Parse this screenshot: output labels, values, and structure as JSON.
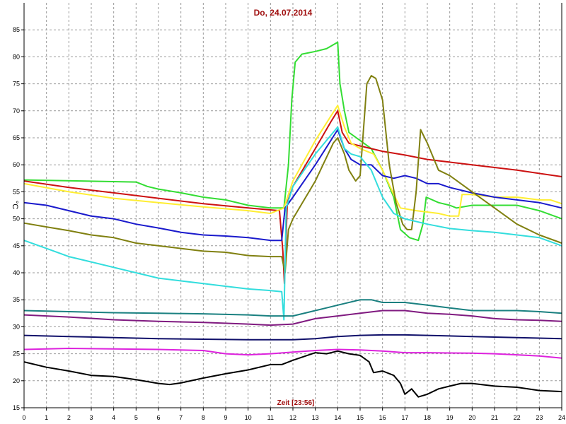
{
  "chart_data": {
    "type": "line",
    "title": "Do, 24.07.2014",
    "xlabel": "Zeit [23:56]",
    "ylabel": "°C",
    "xlim": [
      0,
      24
    ],
    "ylim": [
      15,
      90
    ],
    "xticks": [
      0,
      1,
      2,
      3,
      4,
      5,
      6,
      7,
      8,
      9,
      10,
      11,
      12,
      13,
      14,
      15,
      16,
      17,
      18,
      19,
      20,
      21,
      22,
      23,
      24
    ],
    "yticks": [
      15,
      20,
      25,
      30,
      35,
      40,
      45,
      50,
      55,
      60,
      65,
      70,
      75,
      80,
      85
    ],
    "grid": true,
    "colors": {
      "background": "#ffffff",
      "grid": "#9a9a9a",
      "axis": "#000000"
    },
    "series": [
      {
        "color": "#33dd33",
        "points": [
          [
            0,
            57.2
          ],
          [
            5,
            56.8
          ],
          [
            5.5,
            56
          ],
          [
            6,
            55.5
          ],
          [
            7,
            54.8
          ],
          [
            8,
            54
          ],
          [
            9,
            53.5
          ],
          [
            10,
            52.5
          ],
          [
            11,
            52
          ],
          [
            11.6,
            52
          ],
          [
            11.8,
            60
          ],
          [
            11.95,
            72
          ],
          [
            12.1,
            79
          ],
          [
            12.4,
            80.5
          ],
          [
            13,
            81
          ],
          [
            13.5,
            81.5
          ],
          [
            14,
            82.7
          ],
          [
            14.1,
            75
          ],
          [
            14.3,
            70
          ],
          [
            14.5,
            66
          ],
          [
            15,
            64.5
          ],
          [
            15.5,
            63
          ],
          [
            16,
            59
          ],
          [
            16.5,
            54
          ],
          [
            16.8,
            48
          ],
          [
            17.2,
            46.5
          ],
          [
            17.6,
            46
          ],
          [
            17.8,
            49
          ],
          [
            17.95,
            54
          ],
          [
            18.5,
            53
          ],
          [
            19,
            52.5
          ],
          [
            19.3,
            52
          ],
          [
            20,
            52.5
          ],
          [
            21,
            52.5
          ],
          [
            22,
            52.5
          ],
          [
            23,
            51.5
          ],
          [
            24,
            50
          ]
        ]
      },
      {
        "color": "#cc1111",
        "points": [
          [
            0,
            57
          ],
          [
            2,
            55.8
          ],
          [
            4,
            54.8
          ],
          [
            6,
            53.8
          ],
          [
            8,
            52.8
          ],
          [
            10,
            52
          ],
          [
            11.4,
            51.5
          ],
          [
            11.55,
            44
          ],
          [
            11.62,
            38
          ],
          [
            11.75,
            53
          ],
          [
            12,
            56
          ],
          [
            13,
            63
          ],
          [
            13.7,
            68
          ],
          [
            14,
            70
          ],
          [
            14.2,
            66
          ],
          [
            14.5,
            64
          ],
          [
            15,
            63.5
          ],
          [
            16,
            62.5
          ],
          [
            17,
            61.8
          ],
          [
            18,
            61
          ],
          [
            20,
            60
          ],
          [
            22,
            59
          ],
          [
            24,
            57.8
          ]
        ]
      },
      {
        "color": "#ffee33",
        "points": [
          [
            0,
            56.5
          ],
          [
            2,
            55
          ],
          [
            4,
            53.8
          ],
          [
            6,
            53
          ],
          [
            8,
            52.2
          ],
          [
            10,
            51.5
          ],
          [
            11,
            51
          ],
          [
            11.6,
            52
          ],
          [
            12,
            57
          ],
          [
            13,
            64.5
          ],
          [
            14,
            71
          ],
          [
            14.3,
            67
          ],
          [
            14.6,
            64
          ],
          [
            15,
            63
          ],
          [
            15.6,
            62
          ],
          [
            16,
            59
          ],
          [
            16.5,
            54.5
          ],
          [
            16.8,
            52
          ],
          [
            17.5,
            51.5
          ],
          [
            18.5,
            51
          ],
          [
            19,
            50.5
          ],
          [
            19.4,
            50.5
          ],
          [
            19.55,
            54.5
          ],
          [
            20,
            54.5
          ],
          [
            21,
            54
          ],
          [
            22,
            54
          ],
          [
            23,
            53.5
          ],
          [
            23.5,
            53.5
          ],
          [
            24,
            52.8
          ]
        ]
      },
      {
        "color": "#1a1acc",
        "points": [
          [
            0,
            53
          ],
          [
            1,
            52.5
          ],
          [
            2,
            51.5
          ],
          [
            3,
            50.5
          ],
          [
            4,
            50
          ],
          [
            5,
            49
          ],
          [
            6,
            48.3
          ],
          [
            7,
            47.5
          ],
          [
            8,
            47
          ],
          [
            9,
            46.8
          ],
          [
            10,
            46.5
          ],
          [
            11,
            46
          ],
          [
            11.5,
            46
          ],
          [
            11.65,
            52
          ],
          [
            12,
            54
          ],
          [
            13,
            60
          ],
          [
            14,
            66.5
          ],
          [
            14.3,
            63
          ],
          [
            14.6,
            61
          ],
          [
            15,
            60
          ],
          [
            15.5,
            60
          ],
          [
            16,
            58
          ],
          [
            16.5,
            57.5
          ],
          [
            17,
            58
          ],
          [
            17.5,
            57.5
          ],
          [
            18,
            56.5
          ],
          [
            18.5,
            56.5
          ],
          [
            19,
            55.8
          ],
          [
            20,
            54.8
          ],
          [
            21,
            54
          ],
          [
            22,
            53.5
          ],
          [
            23,
            53
          ],
          [
            24,
            52
          ]
        ]
      },
      {
        "color": "#808010",
        "points": [
          [
            0,
            49.2
          ],
          [
            1,
            48.5
          ],
          [
            2,
            47.8
          ],
          [
            3,
            47
          ],
          [
            4,
            46.5
          ],
          [
            5,
            45.5
          ],
          [
            6,
            45
          ],
          [
            7,
            44.5
          ],
          [
            8,
            44
          ],
          [
            9,
            43.8
          ],
          [
            10,
            43.2
          ],
          [
            11,
            43
          ],
          [
            11.5,
            43
          ],
          [
            11.65,
            40
          ],
          [
            11.8,
            48
          ],
          [
            12,
            50
          ],
          [
            13,
            57
          ],
          [
            13.8,
            64
          ],
          [
            14,
            65
          ],
          [
            14.3,
            62
          ],
          [
            14.5,
            59
          ],
          [
            14.8,
            57
          ],
          [
            15,
            58
          ],
          [
            15.3,
            75
          ],
          [
            15.5,
            76.5
          ],
          [
            15.7,
            76
          ],
          [
            16,
            72
          ],
          [
            16.3,
            60
          ],
          [
            16.6,
            53
          ],
          [
            16.9,
            49
          ],
          [
            17.1,
            48
          ],
          [
            17.3,
            48
          ],
          [
            17.5,
            55
          ],
          [
            17.7,
            66.5
          ],
          [
            18,
            64
          ],
          [
            18.5,
            59
          ],
          [
            19,
            58
          ],
          [
            20,
            55
          ],
          [
            21,
            52
          ],
          [
            22,
            49
          ],
          [
            23,
            47
          ],
          [
            24,
            45.5
          ]
        ]
      },
      {
        "color": "#33dddd",
        "points": [
          [
            0,
            46
          ],
          [
            1,
            44.5
          ],
          [
            2,
            43
          ],
          [
            3,
            42
          ],
          [
            4,
            41
          ],
          [
            5,
            40
          ],
          [
            6,
            39
          ],
          [
            7,
            38.5
          ],
          [
            8,
            38
          ],
          [
            9,
            37.5
          ],
          [
            10,
            37
          ],
          [
            11,
            36.7
          ],
          [
            11.5,
            36.5
          ],
          [
            11.6,
            31.3
          ],
          [
            11.7,
            52
          ],
          [
            12,
            56
          ],
          [
            13,
            62
          ],
          [
            14,
            67
          ],
          [
            14.3,
            63
          ],
          [
            14.6,
            62
          ],
          [
            15,
            61.5
          ],
          [
            15.5,
            59
          ],
          [
            15.8,
            56
          ],
          [
            16,
            54
          ],
          [
            16.5,
            51
          ],
          [
            17,
            50
          ],
          [
            18,
            49
          ],
          [
            19,
            48.2
          ],
          [
            20,
            47.8
          ],
          [
            21,
            47.5
          ],
          [
            22,
            47
          ],
          [
            23,
            46.5
          ],
          [
            24,
            45
          ]
        ]
      },
      {
        "color": "#1a8080",
        "points": [
          [
            0,
            33
          ],
          [
            2,
            32.8
          ],
          [
            4,
            32.6
          ],
          [
            6,
            32.5
          ],
          [
            8,
            32.4
          ],
          [
            10,
            32.2
          ],
          [
            11,
            32
          ],
          [
            12,
            32
          ],
          [
            13,
            33
          ],
          [
            13.5,
            33.5
          ],
          [
            14,
            34
          ],
          [
            15,
            35
          ],
          [
            15.5,
            35
          ],
          [
            16,
            34.5
          ],
          [
            17,
            34.5
          ],
          [
            18,
            34
          ],
          [
            19,
            33.5
          ],
          [
            20,
            33
          ],
          [
            22,
            33
          ],
          [
            23,
            32.8
          ],
          [
            24,
            32.5
          ]
        ]
      },
      {
        "color": "#801a80",
        "points": [
          [
            0,
            32.2
          ],
          [
            2,
            31.8
          ],
          [
            4,
            31.3
          ],
          [
            6,
            31
          ],
          [
            8,
            30.8
          ],
          [
            10,
            30.5
          ],
          [
            11,
            30.3
          ],
          [
            12,
            30.5
          ],
          [
            13,
            31.5
          ],
          [
            14,
            32
          ],
          [
            15,
            32.5
          ],
          [
            16,
            33
          ],
          [
            17,
            33
          ],
          [
            18,
            32.5
          ],
          [
            19,
            32.3
          ],
          [
            20,
            32
          ],
          [
            21,
            31.5
          ],
          [
            22,
            31.3
          ],
          [
            23,
            31.2
          ],
          [
            24,
            31
          ]
        ]
      },
      {
        "color": "#10106a",
        "points": [
          [
            0,
            28.4
          ],
          [
            2,
            28.2
          ],
          [
            4,
            28
          ],
          [
            6,
            27.8
          ],
          [
            8,
            27.7
          ],
          [
            10,
            27.6
          ],
          [
            12,
            27.6
          ],
          [
            13,
            27.8
          ],
          [
            14,
            28.2
          ],
          [
            15,
            28.4
          ],
          [
            16,
            28.5
          ],
          [
            17,
            28.5
          ],
          [
            18,
            28.4
          ],
          [
            20,
            28.2
          ],
          [
            22,
            28
          ],
          [
            24,
            27.8
          ]
        ]
      },
      {
        "color": "#dd22dd",
        "points": [
          [
            0,
            25.8
          ],
          [
            2,
            26
          ],
          [
            4,
            25.9
          ],
          [
            6,
            25.8
          ],
          [
            8,
            25.6
          ],
          [
            9,
            25
          ],
          [
            10,
            24.8
          ],
          [
            11,
            25
          ],
          [
            12,
            25.3
          ],
          [
            13,
            25.6
          ],
          [
            14,
            25.8
          ],
          [
            15,
            25.7
          ],
          [
            16,
            25.5
          ],
          [
            17,
            25.2
          ],
          [
            18,
            25.2
          ],
          [
            20,
            25.1
          ],
          [
            21,
            25
          ],
          [
            22,
            24.8
          ],
          [
            23,
            24.6
          ],
          [
            24,
            24.2
          ]
        ]
      },
      {
        "color": "#000000",
        "points": [
          [
            0,
            23.5
          ],
          [
            1,
            22.5
          ],
          [
            2,
            21.8
          ],
          [
            3,
            21
          ],
          [
            4,
            20.8
          ],
          [
            5,
            20.2
          ],
          [
            6,
            19.5
          ],
          [
            6.5,
            19.3
          ],
          [
            7,
            19.6
          ],
          [
            8,
            20.5
          ],
          [
            9,
            21.3
          ],
          [
            10,
            22
          ],
          [
            11,
            23
          ],
          [
            11.5,
            23
          ],
          [
            12,
            23.8
          ],
          [
            13,
            25.2
          ],
          [
            13.5,
            25
          ],
          [
            14,
            25.5
          ],
          [
            14.5,
            25
          ],
          [
            15,
            24.7
          ],
          [
            15.4,
            23.5
          ],
          [
            15.6,
            21.5
          ],
          [
            16,
            21.8
          ],
          [
            16.5,
            21
          ],
          [
            16.8,
            19.5
          ],
          [
            17,
            17.5
          ],
          [
            17.3,
            18.5
          ],
          [
            17.6,
            17
          ],
          [
            18,
            17.5
          ],
          [
            18.5,
            18.5
          ],
          [
            19,
            19
          ],
          [
            19.5,
            19.5
          ],
          [
            20,
            19.5
          ],
          [
            21,
            19
          ],
          [
            22,
            18.8
          ],
          [
            23,
            18.2
          ],
          [
            24,
            18
          ]
        ]
      }
    ]
  }
}
